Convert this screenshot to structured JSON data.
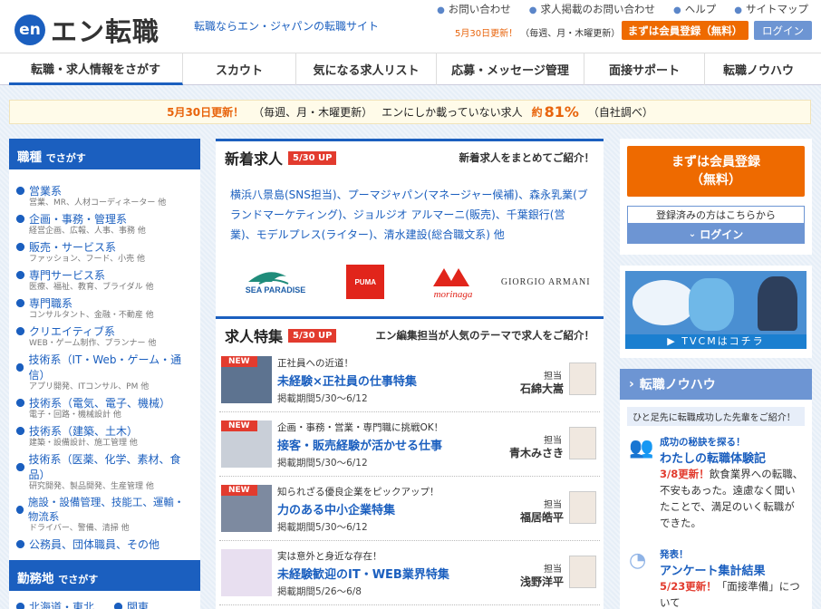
{
  "header": {
    "logo_mark": "en",
    "logo_name": "エン転職",
    "tagline": "転職ならエン・ジャパンの転職サイト",
    "util_links": [
      "お問い合わせ",
      "求人掲載のお問い合わせ",
      "ヘルプ",
      "サイトマップ"
    ],
    "update_date": "5月30日更新！",
    "update_note": "（毎週、月・木曜更新）",
    "register_button": "まずは会員登録（無料）",
    "login_button": "ログイン"
  },
  "nav": [
    "転職・求人情報をさがす",
    "スカウト",
    "気になる求人リスト",
    "応募・メッセージ管理",
    "面接サポート",
    "転職ノウハウ"
  ],
  "banner": {
    "date": "5月30日更新！",
    "schedule": "（毎週、月・木曜更新）",
    "lead": "エンにしか載っていない求人",
    "approx": "約",
    "percent": "81%",
    "source": "（自社調べ）"
  },
  "left": {
    "heading": "職種",
    "heading_suffix": "でさがす",
    "categories": [
      {
        "title": "営業系",
        "sub": "営業、MR、人材コーディネーター 他"
      },
      {
        "title": "企画・事務・管理系",
        "sub": "経営企画、広報、人事、事務 他"
      },
      {
        "title": "販売・サービス系",
        "sub": "ファッション、フード、小売 他"
      },
      {
        "title": "専門サービス系",
        "sub": "医療、福祉、教育、ブライダル 他"
      },
      {
        "title": "専門職系",
        "sub": "コンサルタント、金融・不動産 他"
      },
      {
        "title": "クリエイティブ系",
        "sub": "WEB・ゲーム制作、プランナー 他"
      },
      {
        "title": "技術系（IT・Web・ゲーム・通信）",
        "sub": "アプリ開発、ITコンサル、PM 他"
      },
      {
        "title": "技術系（電気、電子、機械）",
        "sub": "電子・回路・機械設計 他"
      },
      {
        "title": "技術系（建築、土木）",
        "sub": "建築・設備設計、施工管理 他"
      },
      {
        "title": "技術系（医薬、化学、素材、食品）",
        "sub": "研究開発、製品開発、生産管理 他"
      },
      {
        "title": "施設・設備管理、技能工、運輸・物流系",
        "sub": "ドライバー、警備、清掃 他"
      },
      {
        "title": "公務員、団体職員、その他",
        "sub": ""
      }
    ],
    "heading2": "勤務地",
    "heading2_suffix": "でさがす",
    "regions": [
      "北海道・東北",
      "関東"
    ]
  },
  "new_jobs": {
    "title": "新着求人",
    "badge": "5/30 UP",
    "right_text": "新着求人をまとめてご紹介！",
    "companies": "横浜八景島(SNS担当)、プーマジャパン(マネージャー候補)、森永乳業(ブランドマーケティング)、ジョルジオ アルマーニ(販売)、千葉銀行(営業)、モデルプレス(ライター)、清水建設(総合職文系) 他",
    "logos": [
      "SEA PARADISE",
      "PUMA",
      "morinaga",
      "GIORGIO ARMANI"
    ]
  },
  "features": {
    "title": "求人特集",
    "badge": "5/30 UP",
    "right_text": "エン編集担当が人気のテーマで求人をご紹介！",
    "new_label": "NEW",
    "tan_label": "担当",
    "items": [
      {
        "new": true,
        "sub": "正社員への近道！",
        "title": "未経験×正社員の仕事特集",
        "period": "掲載期間5/30〜6/12",
        "staff": "石綿大嵩"
      },
      {
        "new": true,
        "sub": "企画・事務・営業・専門職に挑戦OK！",
        "title": "接客・販売経験が活かせる仕事",
        "period": "掲載期間5/30〜6/12",
        "staff": "青木みさき"
      },
      {
        "new": true,
        "sub": "知られざる優良企業をピックアップ！",
        "title": "力のある中小企業特集",
        "period": "掲載期間5/30〜6/12",
        "staff": "福居皓平"
      },
      {
        "new": false,
        "sub": "実は意外と身近な存在！",
        "title": "未経験歓迎のIT・WEB業界特集",
        "period": "掲載期間5/26〜6/8",
        "staff": "浅野洋平"
      }
    ]
  },
  "right": {
    "register_line1": "まずは会員登録",
    "register_line2": "（無料）",
    "registered_note": "登録済みの方はこちらから",
    "login": "ログイン",
    "tvcm_label": "TVCMはコチラ",
    "knowhow_title": "転職ノウハウ",
    "knowhow_note": "ひと足先に転職成功した先輩をご紹介！",
    "kh1_sub": "成功の秘訣を探る！",
    "kh1_title": "わたしの転職体験記",
    "kh1_update": "3/8更新！",
    "kh1_body": "飲食業界への転職、不安もあった。遠慮なく聞いたことで、満足のいく転職ができた。",
    "kh2_sub": "発表！",
    "kh2_title": "アンケート集計結果",
    "kh2_update": "5/23更新！",
    "kh2_body": "「面接準備」について"
  },
  "colors": {
    "brand_blue": "#1b5fbf",
    "accent_orange": "#ee6a00",
    "red": "#e23b2e"
  }
}
